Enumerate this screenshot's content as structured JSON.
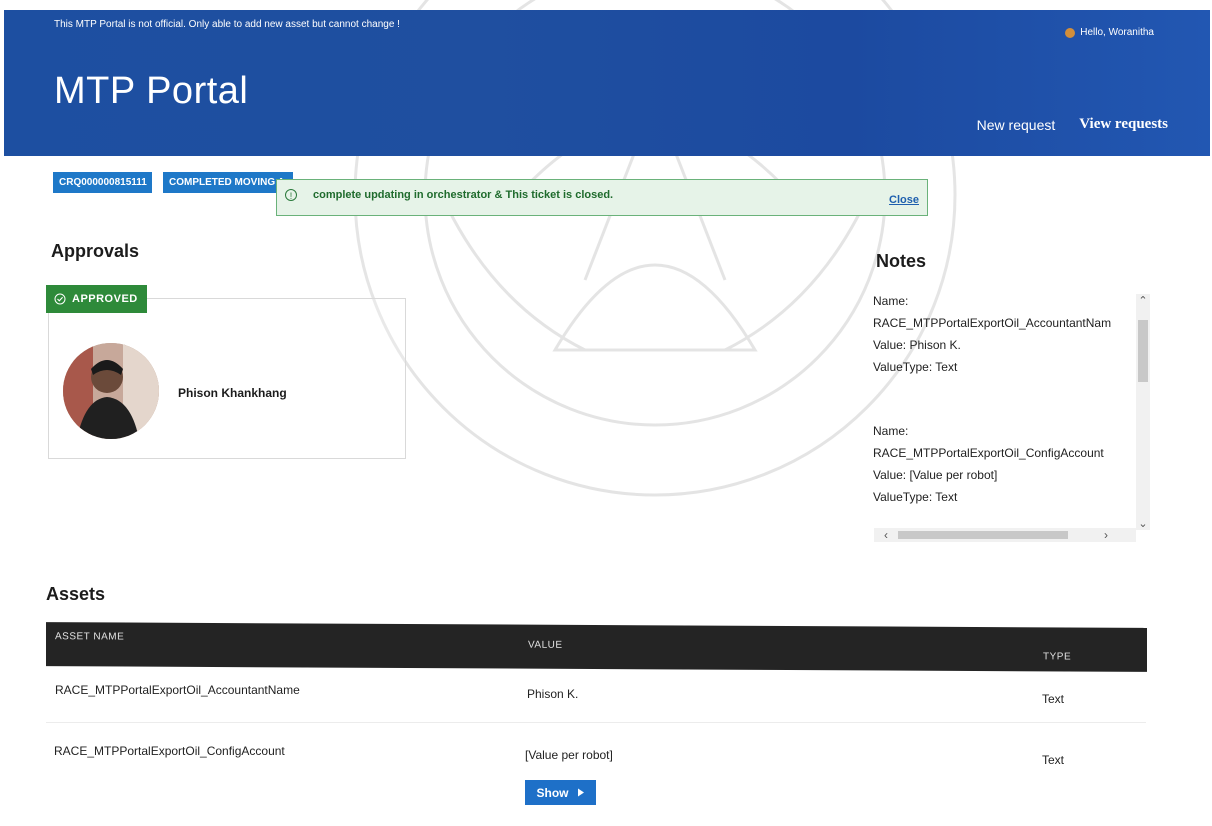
{
  "header": {
    "disclaimer": "This MTP Portal is not official. Only able to add new asset but cannot change !",
    "greeting": "Hello, Woranitha",
    "title": "MTP Portal",
    "nav": {
      "new_request": "New request",
      "view_requests": "View requests"
    }
  },
  "ticket": {
    "id": "CRQ000000815111",
    "status": "COMPLETED MOVING A"
  },
  "alert": {
    "message": "complete updating in orchestrator & This ticket is closed.",
    "close_label": "Close",
    "color": "#1f6b2d"
  },
  "approvals": {
    "title": "Approvals",
    "badge": "APPROVED",
    "approver_name": "Phison Khankhang"
  },
  "notes": {
    "title": "Notes",
    "items": [
      {
        "name": "Name:",
        "key": "RACE_MTPPortalExportOil_AccountantNam",
        "value": "Value: Phison K.",
        "type": "ValueType: Text"
      },
      {
        "name": "Name:",
        "key": "RACE_MTPPortalExportOil_ConfigAccount",
        "value": "Value: [Value per robot]",
        "type": "ValueType: Text"
      }
    ]
  },
  "assets": {
    "title": "Assets",
    "columns": [
      "ASSET NAME",
      "VALUE",
      "TYPE"
    ],
    "rows": [
      {
        "name": "RACE_MTPPortalExportOil_AccountantName",
        "value": "Phison K.",
        "type": "Text"
      },
      {
        "name": "RACE_MTPPortalExportOil_ConfigAccount",
        "value": "[Value per robot]",
        "type": "Text"
      }
    ],
    "show_label": "Show"
  },
  "colors": {
    "header_blue": "#1d4fa1",
    "badge_blue": "#1e78c8",
    "approved_green": "#2e8a3a",
    "table_head": "#242424"
  }
}
